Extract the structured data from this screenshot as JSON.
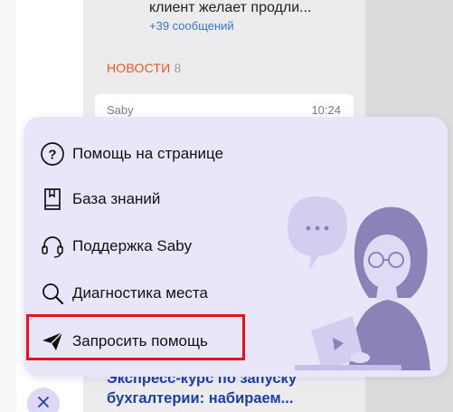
{
  "chat": {
    "preview_text": "клиент желает продли...",
    "more_messages": "+39 сообщений"
  },
  "news": {
    "header": "НОВОСТИ",
    "count": "8",
    "card": {
      "source": "Saby",
      "time": "10:24"
    },
    "bottom_title": "Экспресс-курс по запуску бухгалтерии: набираем..."
  },
  "help_menu": {
    "items": [
      {
        "label": "Помощь на странице",
        "icon": "question-circle-icon"
      },
      {
        "label": "База знаний",
        "icon": "book-icon"
      },
      {
        "label": "Поддержка Saby",
        "icon": "headset-icon"
      },
      {
        "label": "Диагностика места",
        "icon": "magnifier-icon"
      },
      {
        "label": "Запросить помощь",
        "icon": "paper-plane-icon"
      }
    ],
    "highlighted_item": "Запросить помощь"
  },
  "colors": {
    "accent_orange": "#e8541e",
    "link_blue": "#3d73c4",
    "popup_bg": "#eae6fa",
    "highlight_red": "#e3121b"
  }
}
